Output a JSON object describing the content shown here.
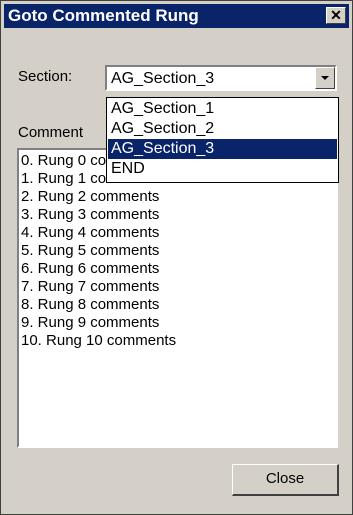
{
  "window": {
    "title": "Goto Commented Rung",
    "close_glyph": "✕",
    "title_bar_color": "#0a246a",
    "face_color": "#d4d0c8"
  },
  "section": {
    "label": "Section:",
    "value": "AG_Section_3",
    "dropdown_open": true,
    "options": [
      {
        "label": "AG_Section_1",
        "selected": false
      },
      {
        "label": "AG_Section_2",
        "selected": false
      },
      {
        "label": "AG_Section_3",
        "selected": true
      },
      {
        "label": "END",
        "selected": false
      }
    ]
  },
  "comments": {
    "label": "Comment",
    "items": [
      "0. Rung 0 comments",
      "1. Rung 1 comments",
      "2. Rung 2 comments",
      "3. Rung 3 comments",
      "4. Rung 4 comments",
      "5. Rung 5 comments",
      "6. Rung 6 comments",
      "7. Rung 7 comments",
      "8. Rung 8 comments",
      "9. Rung 9 comments",
      "10. Rung 10 comments"
    ]
  },
  "buttons": {
    "close_label": "Close"
  }
}
